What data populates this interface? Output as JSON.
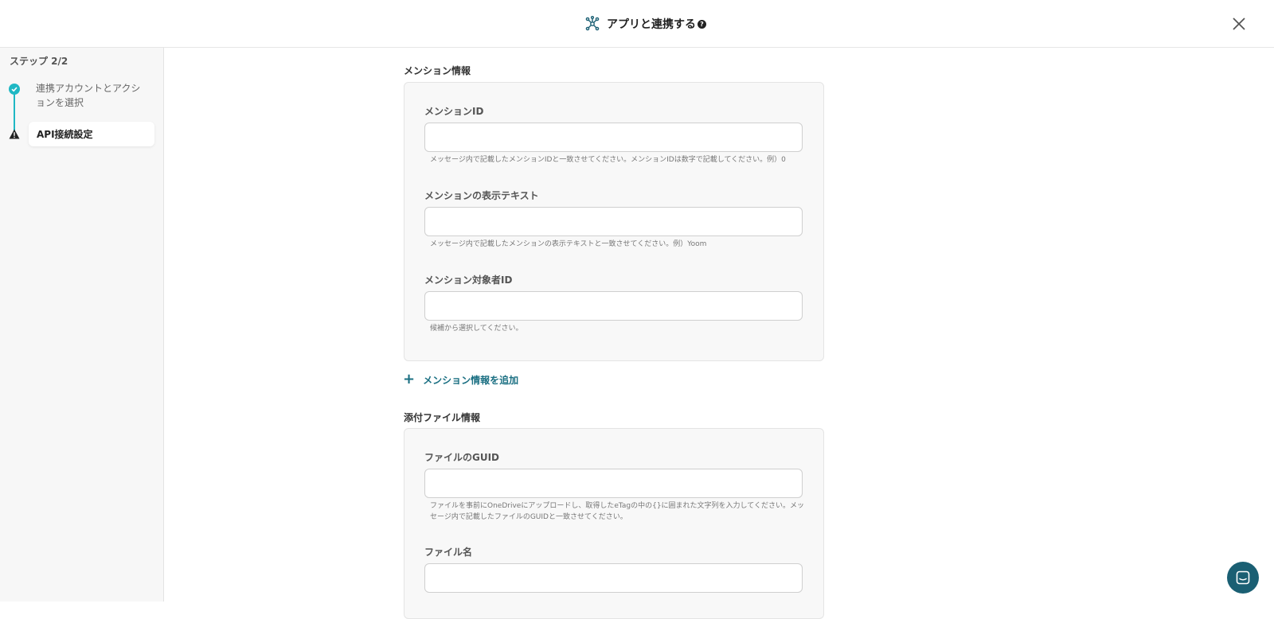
{
  "header": {
    "title": "アプリと連携する",
    "help_icon": "?",
    "icons": {
      "app": "network-nodes-icon",
      "close": "close-icon",
      "help": "help-circle-icon"
    }
  },
  "sidebar": {
    "step_label": "ステップ 2/2",
    "steps": [
      {
        "label": "連携アカウントとアクションを選択",
        "status": "completed",
        "icon": "check-circle-icon"
      },
      {
        "label": "API接続設定",
        "status": "current-warning",
        "icon": "warning-icon"
      }
    ]
  },
  "mention_section": {
    "title": "メンション情報",
    "fields": [
      {
        "label": "メンションID",
        "value": "",
        "hint": "メッセージ内で記載したメンションIDと一致させてください。メンションIDは数字で記載してください。例）0"
      },
      {
        "label": "メンションの表示テキスト",
        "value": "",
        "hint": "メッセージ内で記載したメンションの表示テキストと一致させてください。例）Yoom"
      },
      {
        "label": "メンション対象者ID",
        "value": "",
        "hint": "候補から選択してください。"
      }
    ],
    "add_label": "メンション情報を追加",
    "add_icon": "plus-icon"
  },
  "attachment_section": {
    "title": "添付ファイル情報",
    "fields": [
      {
        "label": "ファイルのGUID",
        "value": "",
        "hint": "ファイルを事前にOneDriveにアップロードし、取得したeTagの中の{}に囲まれた文字列を入力してください。メッセージ内で記載したファイルのGUIDと一致させてください。"
      },
      {
        "label": "ファイル名",
        "value": ""
      }
    ]
  },
  "chat_widget": {
    "icon": "chat-bubble-icon"
  },
  "colors": {
    "accent": "#1fb8c4",
    "link": "#1a6f82",
    "chat": "#1a5f73",
    "panel_bg": "#f8f8f8"
  }
}
